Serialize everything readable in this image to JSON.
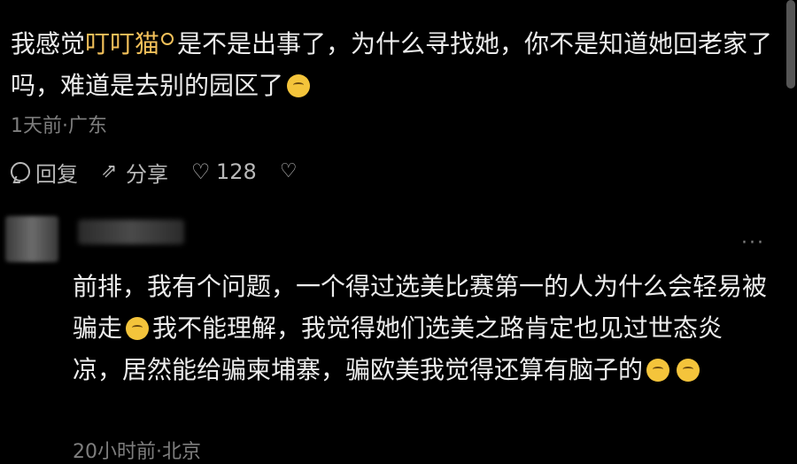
{
  "comment1": {
    "text_before": "我感觉",
    "mention": "叮叮猫",
    "text_after": "是不是出事了，为什么寻找她，你不是知道她回老家了吗，难道是去别的园区了",
    "emoji_name": "thinking-face-emoji",
    "meta": "1天前·广东",
    "actions": {
      "reply": "回复",
      "share": "分享",
      "likes": "128"
    }
  },
  "comment2": {
    "text": "前排，我有个问题，一个得过选美比赛第一的人为什么会轻易被骗走",
    "text2": "我不能理解，我觉得她们选美之路肯定也见过世态炎凉，居然能给骗柬埔寨，骗欧美我觉得还算有脑子的",
    "more": "···",
    "meta": "20小时前·北京"
  },
  "colors": {
    "background": "#000000",
    "mention": "#f2c05a",
    "meta": "#7e7e7e"
  }
}
